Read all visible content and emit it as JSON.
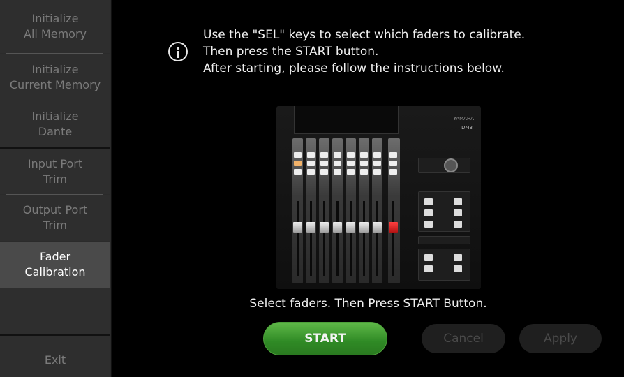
{
  "sidebar": {
    "items": [
      {
        "line1": "Initialize",
        "line2": "All Memory"
      },
      {
        "line1": "Initialize",
        "line2": "Current Memory"
      },
      {
        "line1": "Initialize",
        "line2": "Dante"
      },
      {
        "line1": "Input Port",
        "line2": "Trim"
      },
      {
        "line1": "Output Port",
        "line2": "Trim"
      },
      {
        "line1": "Fader",
        "line2": "Calibration"
      }
    ],
    "exit_label": "Exit"
  },
  "main": {
    "instructions": [
      "Use the \"SEL\" keys to select which faders to calibrate.",
      "Then press the START button.",
      "After starting, please follow the instructions below."
    ],
    "console": {
      "brand": "YAMAHA",
      "model": "DM3"
    },
    "status_message": "Select faders. Then Press START Button.",
    "buttons": {
      "start": "START",
      "cancel": "Cancel",
      "apply": "Apply"
    }
  },
  "colors": {
    "active_item_bg": "#4a4a4a",
    "start_button": "#3a9a2c",
    "disabled_text": "#4a4a4a",
    "selected_fader_knob": "#e02020"
  }
}
